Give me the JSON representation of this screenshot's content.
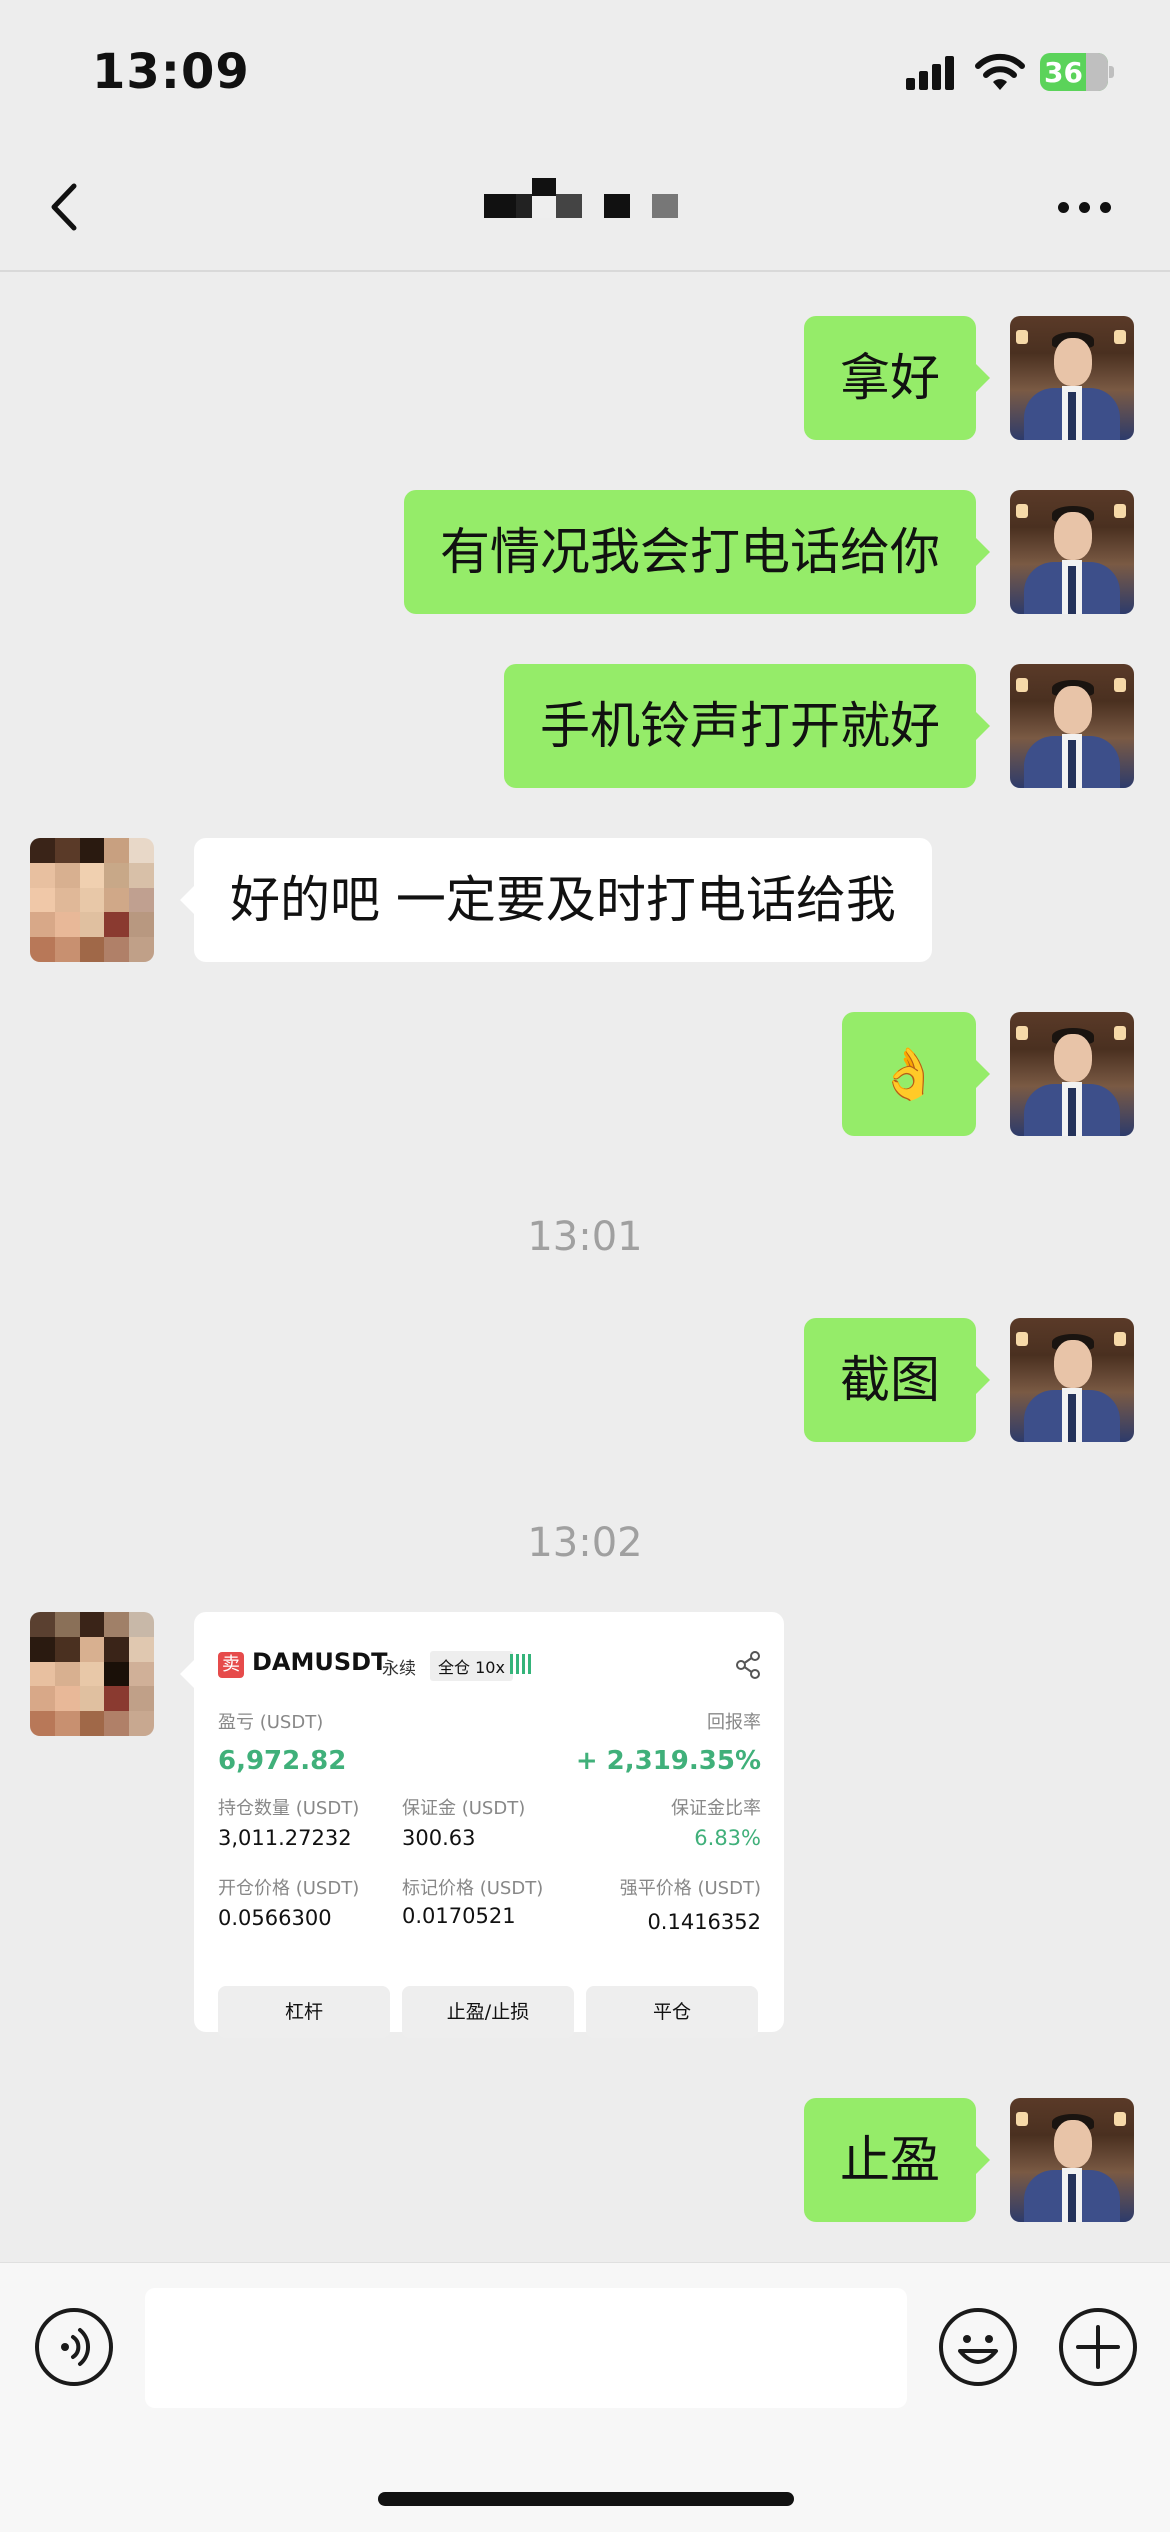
{
  "status_bar": {
    "time": "13:09",
    "battery": "36"
  },
  "nav": {
    "title_obscured": true
  },
  "messages": [
    {
      "side": "me",
      "text": "拿好"
    },
    {
      "side": "me",
      "text": "有情况我会打电话给你"
    },
    {
      "side": "me",
      "text": "手机铃声打开就好"
    },
    {
      "side": "other",
      "text": "好的吧 一定要及时打电话给我"
    },
    {
      "side": "me",
      "text": "👌"
    },
    {
      "side": "time",
      "text": "13:01"
    },
    {
      "side": "me",
      "text": "截图"
    },
    {
      "side": "time",
      "text": "13:02"
    },
    {
      "side": "other",
      "type": "trade-card"
    },
    {
      "side": "me",
      "text": "止盈"
    }
  ],
  "trade_card": {
    "sell_badge": "卖",
    "symbol": "DAMUSDT",
    "contract_type": "永续",
    "margin_mode": "全仓 10x",
    "pnl_label": "盈亏 (USDT)",
    "pnl_value": "6,972.82",
    "roe_label": "回报率",
    "roe_value": "+ 2,319.35%",
    "size_label": "持仓数量 (USDT)",
    "size_value": "3,011.27232",
    "margin_label": "保证金 (USDT)",
    "margin_value": "300.63",
    "margin_ratio_label": "保证金比率",
    "margin_ratio_value": "6.83%",
    "entry_label": "开仓价格 (USDT)",
    "entry_value": "0.0566300",
    "mark_label": "标记价格 (USDT)",
    "mark_value": "0.0170521",
    "liq_label": "强平价格 (USDT)",
    "liq_value": "0.1416352",
    "buttons": [
      "杠杆",
      "止盈/止损",
      "平仓"
    ]
  },
  "input_bar": {
    "placeholder": ""
  },
  "colors": {
    "bubble_me": "#95ec69",
    "bubble_other": "#ffffff",
    "background": "#ededed",
    "profit_green": "#40b07a"
  }
}
